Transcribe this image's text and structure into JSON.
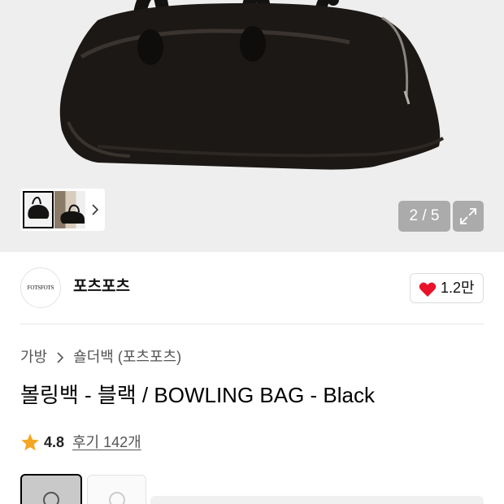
{
  "gallery": {
    "current_page": 2,
    "total_pages": 5,
    "pager_text": "2 / 5",
    "thumbnail_next_icon": "chevron-right-icon",
    "expand_icon": "expand-icon",
    "background": "#eeeeee"
  },
  "brand": {
    "logo_text": "FOTSFOTS",
    "name": "포츠포츠",
    "like_icon": "heart-icon",
    "like_count": "1.2만",
    "like_color": "#e8132a"
  },
  "breadcrumb": {
    "items": [
      "가방",
      "숄더백 (포츠포츠)"
    ],
    "separator_icon": "chevron-right-icon"
  },
  "product": {
    "title": "볼링백 - 블랙 / BOWLING BAG - Black",
    "rating_icon": "star-icon",
    "rating_color": "#f5a623",
    "rating": "4.8",
    "reviews_text": "후기 142개"
  }
}
